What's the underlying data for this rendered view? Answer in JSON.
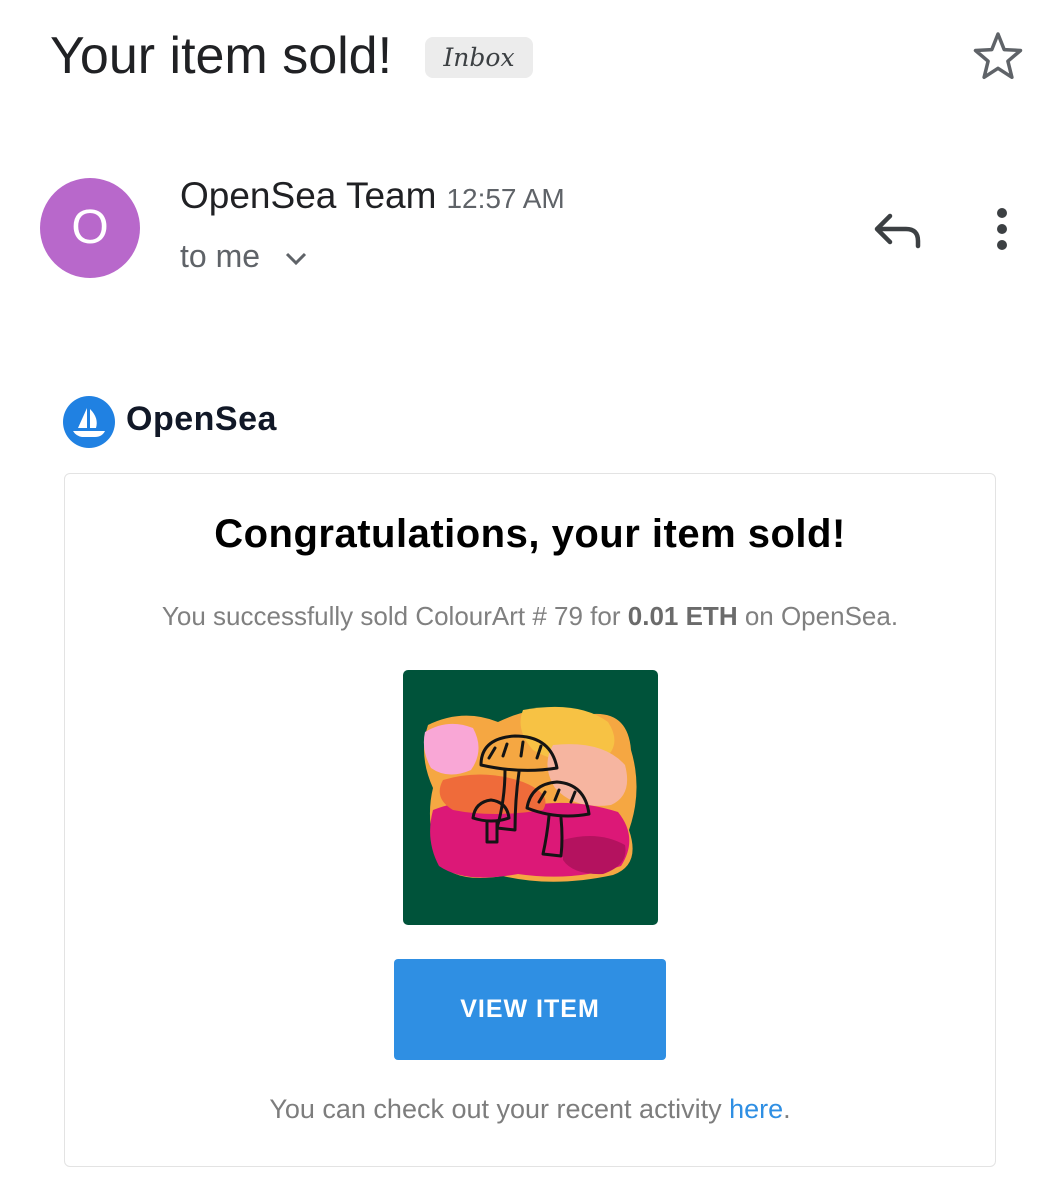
{
  "email": {
    "subject": "Your item sold!",
    "label": "Inbox",
    "sender": {
      "initial": "O",
      "name": "OpenSea Team",
      "time": "12:57 AM",
      "recipient": "to me",
      "avatar_color": "#b868cb"
    },
    "actions": {
      "star_icon": "star-outline-icon",
      "reply_icon": "reply-icon",
      "more_icon": "more-vert-icon"
    }
  },
  "body": {
    "brand": {
      "name": "OpenSea",
      "color": "#2081e2"
    },
    "headline": "Congratulations, your item sold!",
    "sale": {
      "prefix": "You successfully sold ColourArt # 79 for ",
      "price": "0.01 ETH",
      "suffix": " on OpenSea."
    },
    "nft_image": {
      "background": "#00533a",
      "subject": "mushrooms-on-watercolor"
    },
    "button_label": "VIEW ITEM",
    "button_color": "#2f8fe3",
    "activity": {
      "text": "You can check out your recent activity ",
      "link": "here",
      "end": "."
    }
  }
}
